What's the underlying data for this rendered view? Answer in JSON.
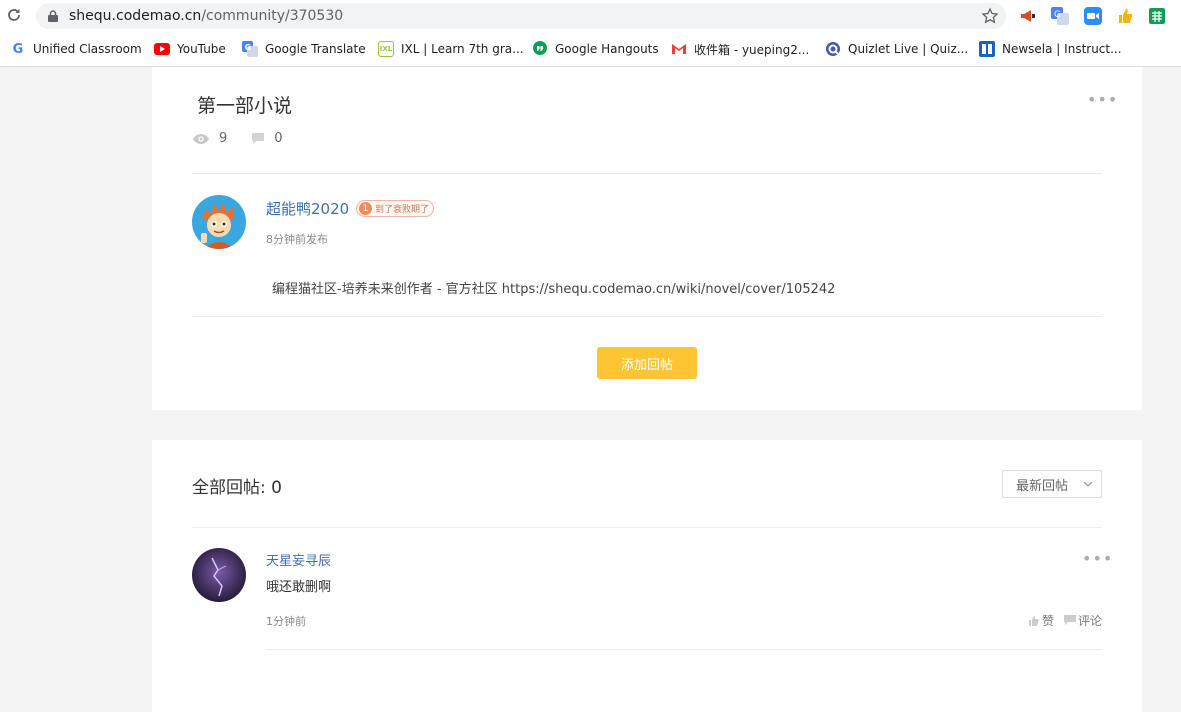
{
  "browser": {
    "url_host": "shequ.codemao.cn",
    "url_path": "/community/370530",
    "bookmarks": [
      {
        "label": "Unified Classroom",
        "icon": "google-g-icon"
      },
      {
        "label": "YouTube",
        "icon": "youtube-icon"
      },
      {
        "label": "Google Translate",
        "icon": "google-translate-icon"
      },
      {
        "label": "IXL | Learn 7th gra...",
        "icon": "ixl-icon"
      },
      {
        "label": "Google Hangouts",
        "icon": "hangouts-icon"
      },
      {
        "label": "收件箱 - yueping2...",
        "icon": "gmail-icon"
      },
      {
        "label": "Quizlet Live | Quiz...",
        "icon": "quizlet-icon"
      },
      {
        "label": "Newsela | Instruct...",
        "icon": "newsela-icon"
      }
    ]
  },
  "post": {
    "title": "第一部小说",
    "views": "9",
    "comments": "0",
    "author": "超能鸭2020",
    "badge_level": "1",
    "badge_text": "到了衰败期了",
    "posted": "8分钟前发布",
    "content": "编程猫社区-培养未来创作者 - 官方社区 https://shequ.codemao.cn/wiki/novel/cover/105242",
    "add_reply_label": "添加回帖"
  },
  "replies": {
    "title": "全部回帖: 0",
    "sort_label": "最新回帖",
    "items": [
      {
        "author": "天星妄寻辰",
        "text": "哦还敢删啊",
        "time": "1分钟前",
        "like_label": "赞",
        "comment_label": "评论"
      }
    ]
  },
  "colors": {
    "accent": "#fec433",
    "link": "#3f6fb0"
  }
}
